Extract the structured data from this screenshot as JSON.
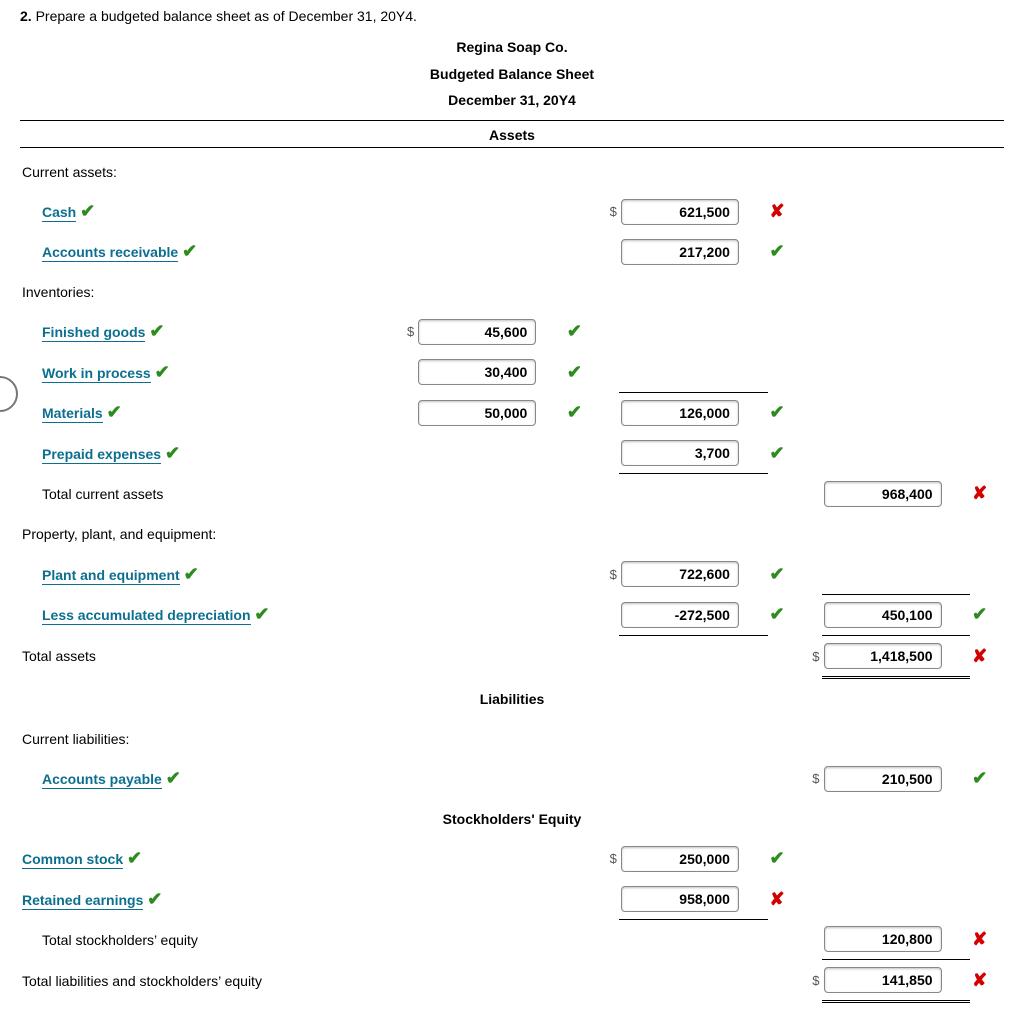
{
  "prompt": {
    "num": "2.",
    "text": " Prepare a budgeted balance sheet as of December 31, 20Y4."
  },
  "header": {
    "company": "Regina Soap Co.",
    "title": "Budgeted Balance Sheet",
    "date": "December 31, 20Y4"
  },
  "sections": {
    "assets": "Assets",
    "liabilities": "Liabilities",
    "equity": "Stockholders' Equity"
  },
  "labels": {
    "current_assets": "Current assets:",
    "cash": "Cash",
    "ar": "Accounts receivable",
    "inventories": "Inventories:",
    "fg": "Finished goods",
    "wip": "Work in process",
    "mat": "Materials",
    "prepaid": "Prepaid expenses",
    "tca": "Total current assets",
    "ppe_hdr": "Property, plant, and equipment:",
    "ppe": "Plant and equipment",
    "accdep": "Less accumulated depreciation",
    "ta": "Total assets",
    "cur_liab": "Current liabilities:",
    "ap": "Accounts payable",
    "cs": "Common stock",
    "re": "Retained earnings",
    "tse": "Total stockholders’ equity",
    "tlse": "Total liabilities and stockholders’ equity"
  },
  "values": {
    "cash": "621,500",
    "ar": "217,200",
    "fg": "45,600",
    "wip": "30,400",
    "mat": "50,000",
    "inv_total": "126,000",
    "prepaid": "3,700",
    "tca": "968,400",
    "ppe": "722,600",
    "accdep": "-272,500",
    "ppe_net": "450,100",
    "ta": "1,418,500",
    "ap": "210,500",
    "cs": "250,000",
    "re": "958,000",
    "tse": "120,800",
    "tlse": "141,850"
  },
  "marks": {
    "cash_lbl": "ok",
    "cash_val": "bad",
    "ar_lbl": "ok",
    "ar_val": "ok",
    "fg_lbl": "ok",
    "fg_val": "ok",
    "wip_lbl": "ok",
    "wip_val": "ok",
    "mat_lbl": "ok",
    "mat_val": "ok",
    "inv_total": "ok",
    "prepaid_lbl": "ok",
    "prepaid_val": "ok",
    "tca": "bad",
    "ppe_lbl": "ok",
    "ppe_val": "ok",
    "accdep_lbl": "ok",
    "accdep_val": "ok",
    "ppe_net": "ok",
    "ta": "bad",
    "ap_lbl": "ok",
    "ap_val": "ok",
    "cs_lbl": "ok",
    "cs_val": "ok",
    "re_lbl": "ok",
    "re_val": "bad",
    "tse": "bad",
    "tlse": "bad"
  },
  "glyphs": {
    "ok": "✔",
    "bad": "✘",
    "cur": "$"
  }
}
